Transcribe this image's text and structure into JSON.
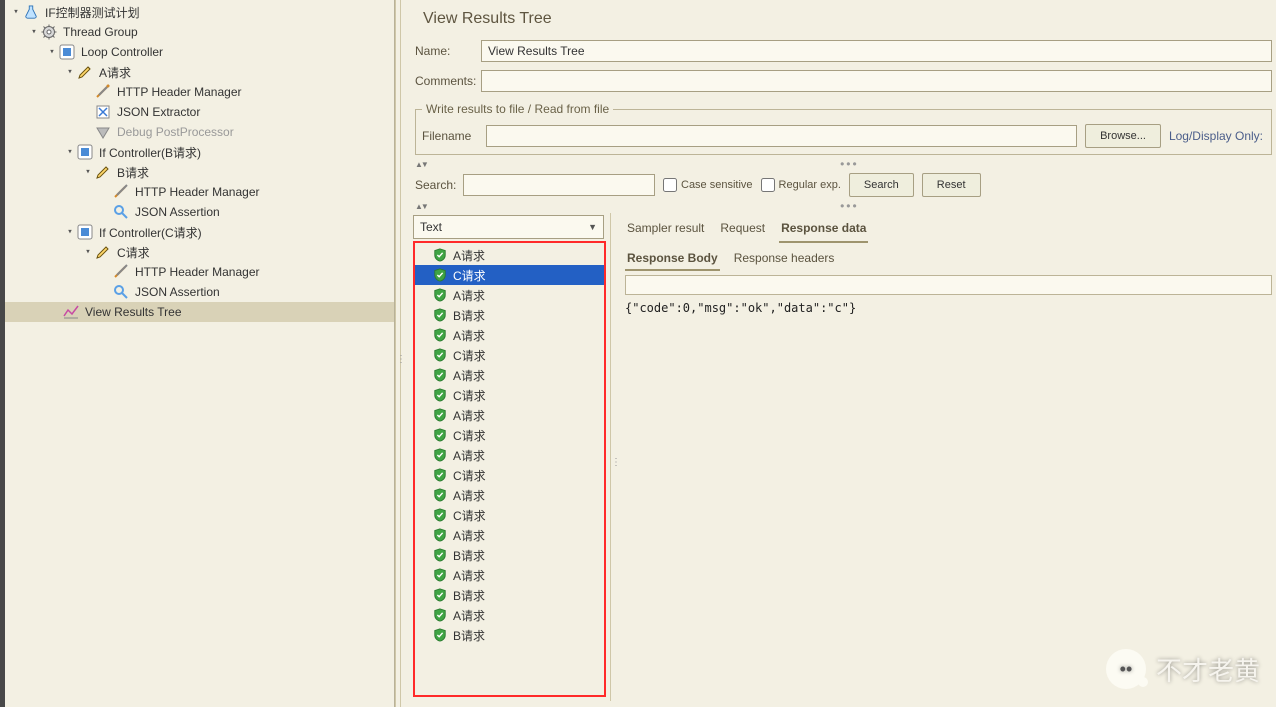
{
  "tree": {
    "root": "IF控制器测试计划",
    "thread_group": "Thread Group",
    "loop_controller": "Loop Controller",
    "a_request": "A请求",
    "http_header_manager": "HTTP Header Manager",
    "json_extractor": "JSON Extractor",
    "debug_postprocessor": "Debug PostProcessor",
    "if_controller_b": "If Controller(B请求)",
    "b_request": "B请求",
    "json_assertion": "JSON Assertion",
    "if_controller_c": "If Controller(C请求)",
    "c_request": "C请求",
    "view_results_tree": "View Results Tree"
  },
  "panel": {
    "title": "View Results Tree",
    "name_label": "Name:",
    "name_value": "View Results Tree",
    "comments_label": "Comments:",
    "comments_value": "",
    "write_legend": "Write results to file / Read from file",
    "filename_label": "Filename",
    "filename_value": "",
    "browse_button": "Browse...",
    "log_display": "Log/Display Only:",
    "search_label": "Search:",
    "search_value": "",
    "case_sensitive": "Case sensitive",
    "regular_exp": "Regular exp.",
    "search_button": "Search",
    "reset_button": "Reset",
    "renderer": "Text",
    "tabs": {
      "sampler": "Sampler result",
      "request": "Request",
      "response": "Response data"
    },
    "subtabs": {
      "body": "Response Body",
      "headers": "Response headers"
    },
    "response_text": "{\"code\":0,\"msg\":\"ok\",\"data\":\"c\"}"
  },
  "results": [
    {
      "label": "A请求"
    },
    {
      "label": "C请求",
      "selected": true
    },
    {
      "label": "A请求"
    },
    {
      "label": "B请求"
    },
    {
      "label": "A请求"
    },
    {
      "label": "C请求"
    },
    {
      "label": "A请求"
    },
    {
      "label": "C请求"
    },
    {
      "label": "A请求"
    },
    {
      "label": "C请求"
    },
    {
      "label": "A请求"
    },
    {
      "label": "C请求"
    },
    {
      "label": "A请求"
    },
    {
      "label": "C请求"
    },
    {
      "label": "A请求"
    },
    {
      "label": "B请求"
    },
    {
      "label": "A请求"
    },
    {
      "label": "B请求"
    },
    {
      "label": "A请求"
    },
    {
      "label": "B请求"
    }
  ],
  "watermark": "不才老黄"
}
